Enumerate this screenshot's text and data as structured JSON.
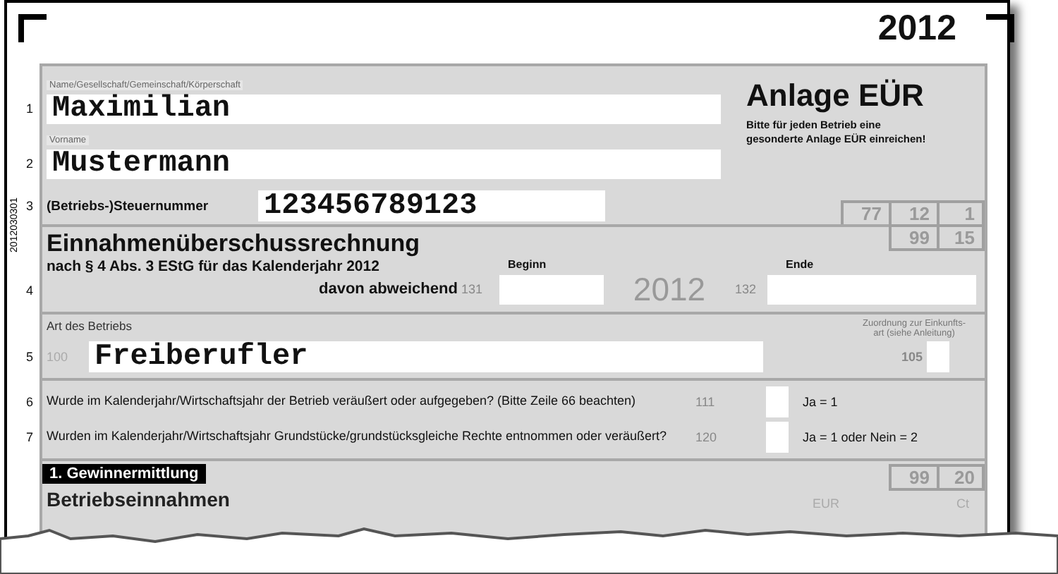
{
  "corner_year": "2012",
  "barcode_text": "2012030301",
  "header": {
    "title": "Anlage EÜR",
    "note": "Bitte für jeden Betrieb eine gesonderte Anlage EÜR einreichen!",
    "codes": [
      "77",
      "12",
      "1"
    ]
  },
  "taxpayer": {
    "name_label": "Name/Gesellschaft/Gemeinschaft/Körperschaft",
    "name_line": "1",
    "name": "Maximilian",
    "first_name_label": "Vorname",
    "first_name_line": "2",
    "first_name": "Mustermann",
    "tax_number_line": "3",
    "tax_number_label": "(Betriebs-)Steuernummer",
    "tax_number": "123456789123"
  },
  "period": {
    "codes": [
      "99",
      "15"
    ],
    "title": "Einnahmenüberschussrechnung",
    "subtitle": "nach § 4 Abs. 3 EStG für das Kalenderjahr 2012",
    "begin_label": "Beginn",
    "end_label": "Ende",
    "line": "4",
    "deviation_label": "davon abweichend",
    "begin_code": "131",
    "year": "2012",
    "end_code": "132"
  },
  "business": {
    "label": "Art des Betriebs",
    "assignment_label": "Zuordnung zur Einkunfts-art (siehe Anleitung)",
    "line": "5",
    "type_code": "100",
    "type": "Freiberufler",
    "assignment_code": "105"
  },
  "questions": [
    {
      "line": "6",
      "text": "Wurde im Kalenderjahr/Wirtschaftsjahr der Betrieb veräußert oder aufgegeben? (Bitte Zeile 66 beachten)",
      "code": "111",
      "answer_hint": "Ja = 1"
    },
    {
      "line": "7",
      "text": "Wurden im Kalenderjahr/Wirtschaftsjahr Grundstücke/grundstücksgleiche Rechte entnommen oder veräußert?",
      "code": "120",
      "answer_hint": "Ja = 1 oder Nein = 2"
    }
  ],
  "section": {
    "title": "1. Gewinnermittlung",
    "codes": [
      "99",
      "20"
    ],
    "heading": "Betriebseinnahmen",
    "currency_label": "EUR",
    "cents_label": "Ct"
  }
}
